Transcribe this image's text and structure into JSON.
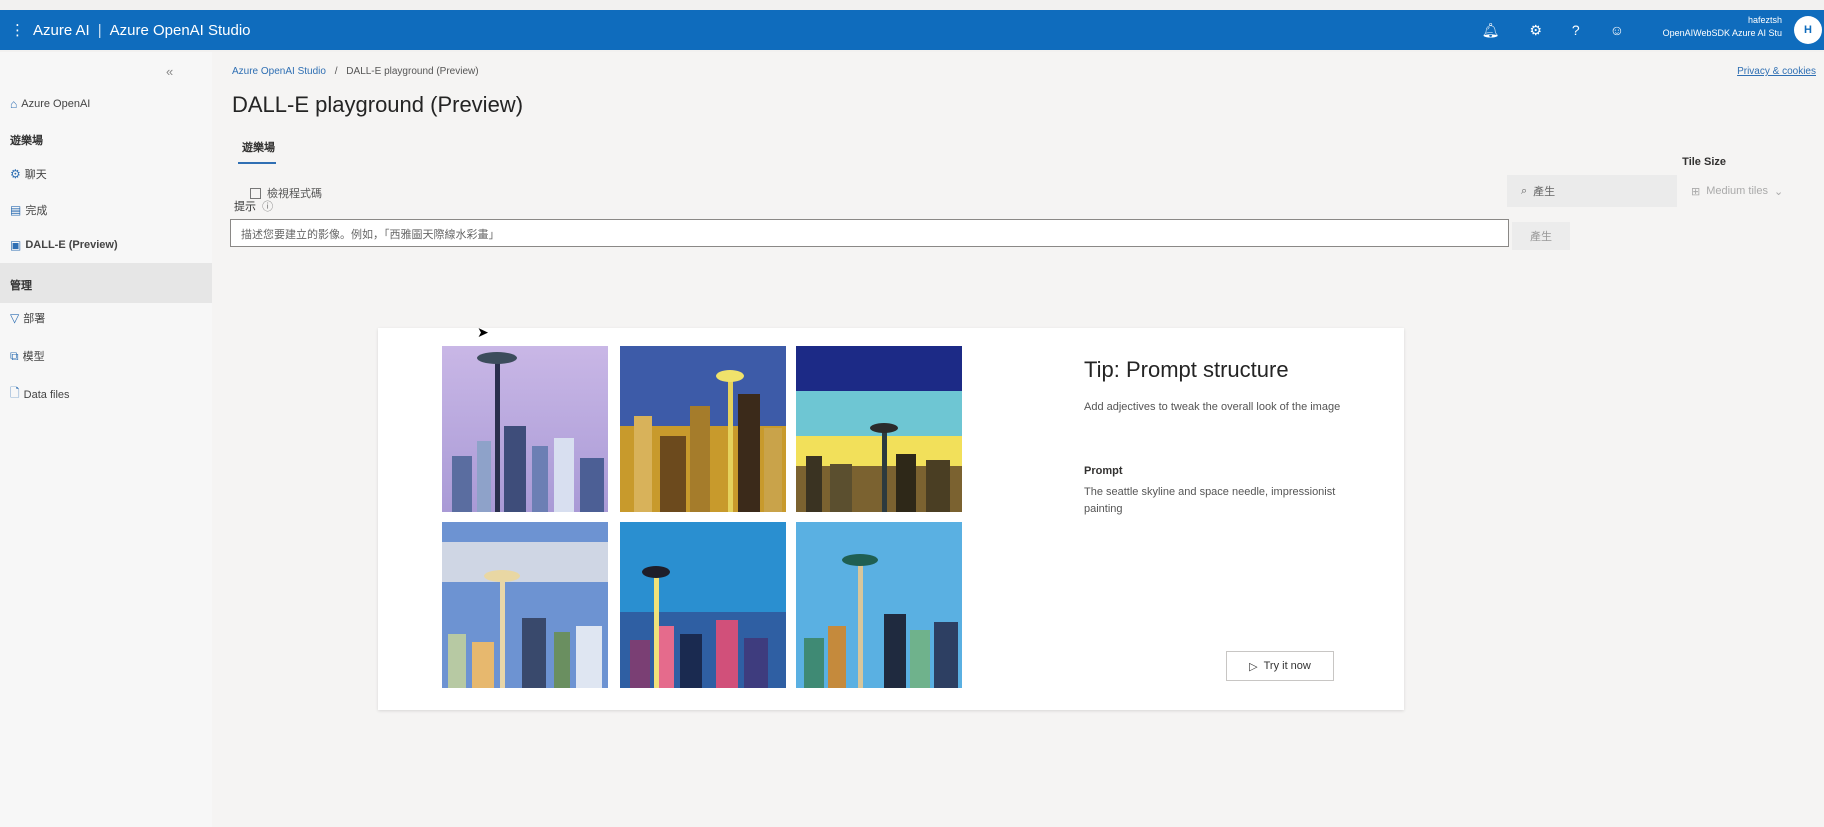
{
  "topbar": {
    "brand_a": "Azure AI",
    "brand_sep": "|",
    "brand_b": "Azure OpenAI Studio",
    "user_name": "hafeztsh",
    "user_sub": "OpenAIWebSDK Azure AI Stu",
    "avatar": "H"
  },
  "sidebar": {
    "azure_openai": "Azure OpenAI",
    "section_playground": "遊樂場",
    "chat": "聊天",
    "completions": "完成",
    "dalle": "DALL-E (Preview)",
    "section_manage": "管理",
    "deployments": "部署",
    "models": "模型",
    "data_files": "Data files"
  },
  "main": {
    "breadcrumb_root": "Azure OpenAI Studio",
    "breadcrumb_sep": "/",
    "breadcrumb_current": "DALL-E playground (Preview)",
    "privacy": "Privacy & cookies",
    "title": "DALL-E playground (Preview)",
    "tab": "遊樂場",
    "checkbox_label": "檢視程式碼",
    "tile_size_label": "Tile Size",
    "generate_label": "產生",
    "tile_size_value": "Medium tiles",
    "prompt_label": "提示",
    "prompt_placeholder": "描述您要建立的影像。例如，「西雅圖天際線水彩畫」",
    "submit_label": "產生"
  },
  "tip": {
    "title": "Tip: Prompt structure",
    "description": "Add adjectives to tweak the overall look of the image",
    "prompt_heading": "Prompt",
    "prompt_text": "The seattle skyline and space needle, impressionist painting",
    "try_label": "Try it now"
  },
  "colors": {
    "accent": "#0f6cbd"
  }
}
